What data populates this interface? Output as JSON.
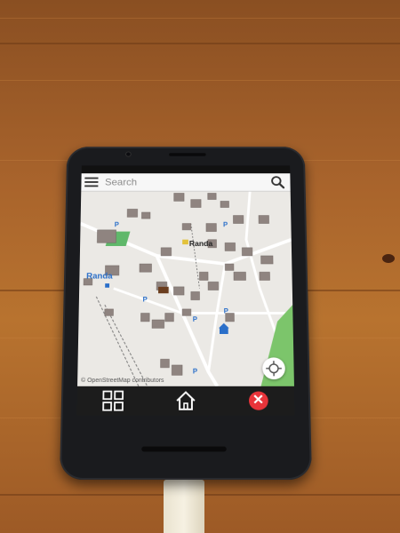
{
  "search": {
    "placeholder": "Search"
  },
  "map": {
    "place_labels": [
      "Randa",
      "Randa"
    ],
    "attribution": "© OpenStreetMap contributors"
  },
  "icons": {
    "menu": "menu-icon",
    "search": "search-icon",
    "locate": "crosshair-icon",
    "grid": "grid-icon",
    "home": "home-icon",
    "close": "close-icon"
  },
  "colors": {
    "close_button": "#e8343a",
    "map_background": "#ebe9e5",
    "label_blue": "#2a6fc9",
    "park_green": "#5fb86a"
  }
}
